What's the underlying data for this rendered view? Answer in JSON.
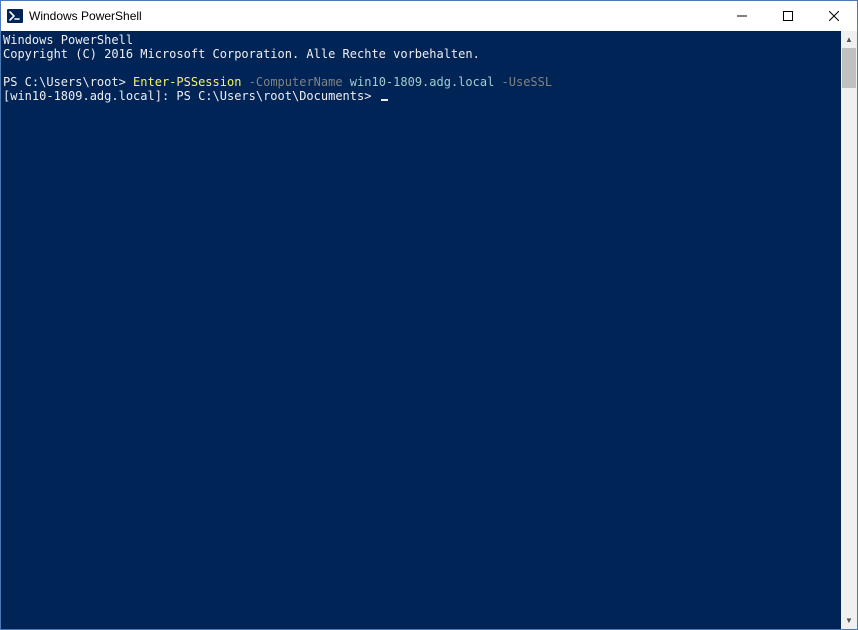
{
  "titlebar": {
    "title": "Windows PowerShell",
    "minimize": "─",
    "maximize": "☐",
    "close": "✕"
  },
  "console": {
    "banner_line1": "Windows PowerShell",
    "banner_line2": "Copyright (C) 2016 Microsoft Corporation. Alle Rechte vorbehalten.",
    "prompt1_prefix": "PS C:\\Users\\root> ",
    "cmdlet": "Enter-PSSession",
    "param1_name": " -ComputerName ",
    "param1_value": "win10-1809.adg.local",
    "param2_name": " -UseSSL",
    "prompt2": "[win10-1809.adg.local]: PS C:\\Users\\root\\Documents> "
  },
  "scrollbar": {
    "up": "▲",
    "down": "▼"
  },
  "colors": {
    "console_bg": "#012456",
    "text": "#eeedf0",
    "cmdlet": "#f3f372",
    "param_name": "#818181",
    "param_value": "#9bcfcf"
  }
}
